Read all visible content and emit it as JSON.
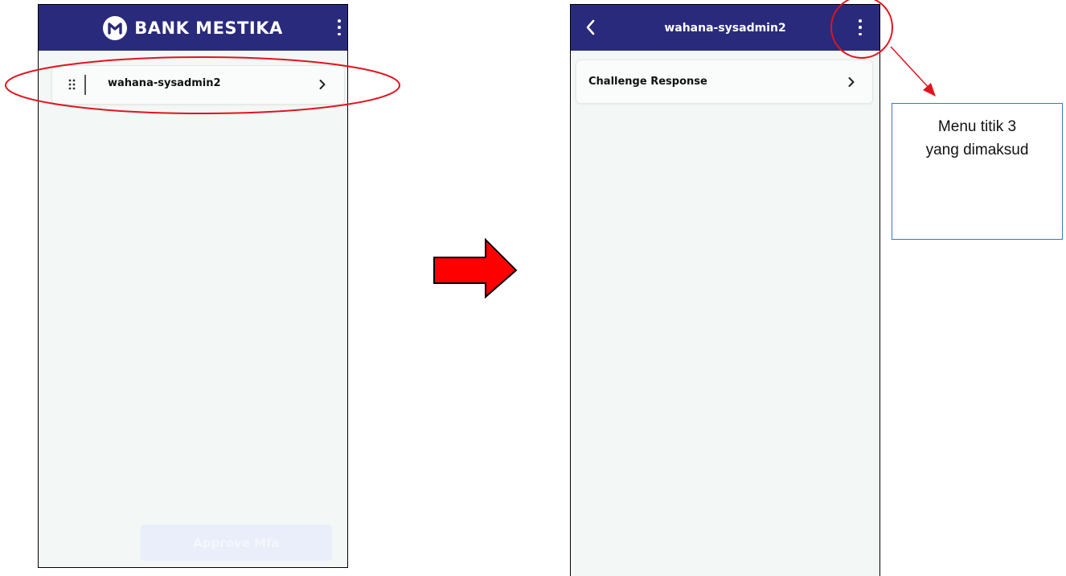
{
  "left_screen": {
    "brand_title": "BANK MESTIKA",
    "brand_logo_letter": "M",
    "account_item": {
      "label": "wahana-sysadmin2"
    },
    "bottom_button": {
      "label": "Approve Mfa"
    }
  },
  "right_screen": {
    "header_title": "wahana-sysadmin2",
    "menu_item": {
      "label": "Challenge Response"
    }
  },
  "annotation": {
    "callout_line1": "Menu titik 3",
    "callout_line2": "yang dimaksud"
  },
  "colors": {
    "appbar": "#2a2a7c",
    "annotation_red": "#e0141e",
    "arrow_fill": "#ff0000",
    "callout_border": "#4472c4",
    "screen_background": "#f3f7f5"
  },
  "icons": {
    "left_bar": [
      "bank-mestika-logo-icon",
      "more-vert-icon"
    ],
    "account_item": [
      "drag-handle-icon",
      "chevron-right-icon"
    ],
    "right_bar": [
      "back-arrow-icon",
      "more-vert-icon"
    ],
    "menu_item": [
      "chevron-right-icon"
    ],
    "annotations": [
      "big-right-arrow-icon",
      "highlight-ellipse",
      "highlight-circle",
      "pointer-arrow-icon"
    ]
  }
}
